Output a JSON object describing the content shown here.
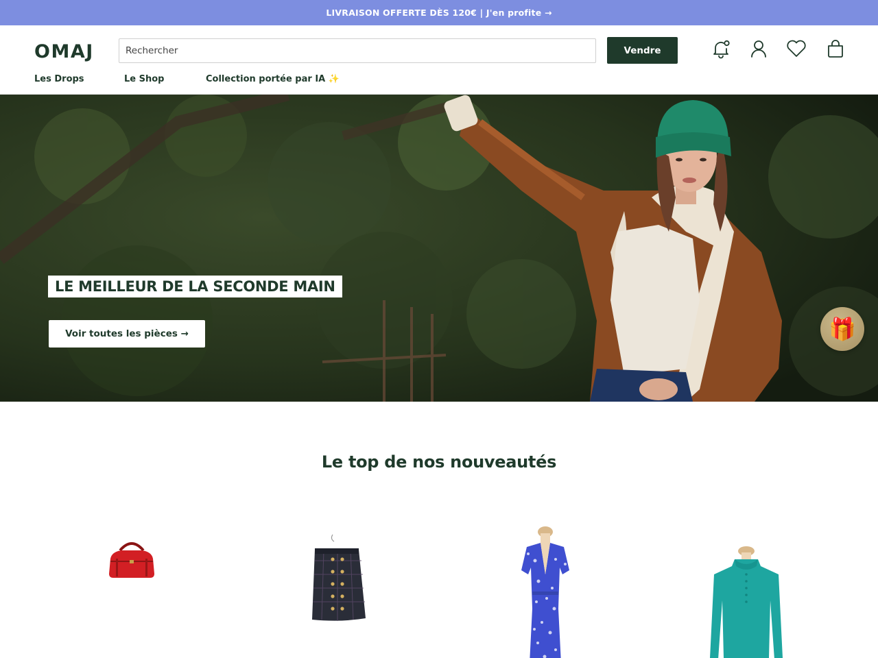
{
  "promo": {
    "text": "LIVRAISON OFFERTE DÈS 120€ | J'en profite →"
  },
  "header": {
    "logo": "OMAJ",
    "search_placeholder": "Rechercher",
    "sell_label": "Vendre",
    "icons": [
      "bell-icon",
      "user-icon",
      "heart-icon",
      "bag-icon"
    ]
  },
  "nav": {
    "items": [
      {
        "label": "Les Drops"
      },
      {
        "label": "Le Shop"
      },
      {
        "label": "Collection portée par IA ✨"
      }
    ]
  },
  "hero": {
    "title": "LE MEILLEUR DE LA SECONDE MAIN",
    "cta": "Voir toutes les pièces →",
    "gift_icon": "gift-icon"
  },
  "section": {
    "title": "Le top de nos nouveautés",
    "products": [
      "red-handbag-image",
      "tweed-skirt-image",
      "floral-dress-image",
      "teal-sweater-image"
    ]
  },
  "colors": {
    "promo_bg": "#7d8ee0",
    "brand_green": "#1f3a2b"
  }
}
